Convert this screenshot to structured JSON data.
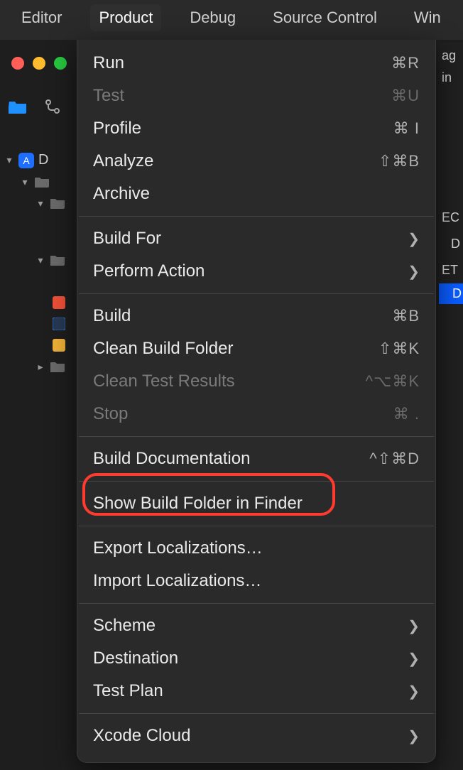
{
  "menubar": {
    "items": [
      "Editor",
      "Product",
      "Debug",
      "Source Control",
      "Win"
    ],
    "active_index": 1
  },
  "menu": {
    "groups": [
      [
        {
          "label": "Run",
          "shortcut": "⌘R"
        },
        {
          "label": "Test",
          "shortcut": "⌘U",
          "disabled": true
        },
        {
          "label": "Profile",
          "shortcut": "⌘ I"
        },
        {
          "label": "Analyze",
          "shortcut": "⇧⌘B"
        },
        {
          "label": "Archive"
        }
      ],
      [
        {
          "label": "Build For",
          "submenu": true
        },
        {
          "label": "Perform Action",
          "submenu": true
        }
      ],
      [
        {
          "label": "Build",
          "shortcut": "⌘B"
        },
        {
          "label": "Clean Build Folder",
          "shortcut": "⇧⌘K"
        },
        {
          "label": "Clean Test Results",
          "shortcut": "^⌥⌘K",
          "disabled": true
        },
        {
          "label": "Stop",
          "shortcut": "⌘ .",
          "disabled": true
        }
      ],
      [
        {
          "label": "Build Documentation",
          "shortcut": "^⇧⌘D"
        }
      ],
      [
        {
          "label": "Show Build Folder in Finder",
          "highlighted": true
        }
      ],
      [
        {
          "label": "Export Localizations…"
        },
        {
          "label": "Import Localizations…"
        }
      ],
      [
        {
          "label": "Scheme",
          "submenu": true
        },
        {
          "label": "Destination",
          "submenu": true
        },
        {
          "label": "Test Plan",
          "submenu": true
        }
      ],
      [
        {
          "label": "Xcode Cloud",
          "submenu": true
        }
      ]
    ]
  },
  "nav": {
    "root_label": "D",
    "right_labels": [
      "ag",
      "in",
      "EC",
      "D",
      "ET",
      "D"
    ]
  }
}
